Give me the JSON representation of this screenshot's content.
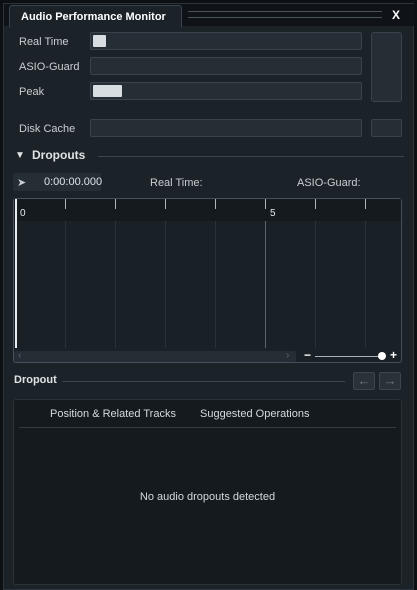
{
  "window": {
    "title": "Audio Performance Monitor",
    "close_label": "X"
  },
  "meters": {
    "real_time": {
      "label": "Real Time",
      "level": 0.05
    },
    "asio_guard": {
      "label": "ASIO-Guard",
      "level": 0.0
    },
    "peak": {
      "label": "Peak",
      "level": 0.11
    },
    "disk_cache": {
      "label": "Disk Cache",
      "level": 0.0
    }
  },
  "dropouts": {
    "title": "Dropouts",
    "time_value": "0:00:00.000",
    "real_time_label": "Real Time:",
    "asio_guard_label": "ASIO-Guard:",
    "ruler_labels": [
      "0",
      "5"
    ]
  },
  "dropout_list": {
    "title": "Dropout",
    "columns": [
      "Position & Related Tracks",
      "Suggested Operations"
    ],
    "empty_message": "No audio dropouts detected"
  },
  "icons": {
    "section_toggle": "triangle-down-icon",
    "time_icon": "pin-icon",
    "prev": "arrow-left-icon",
    "next": "arrow-right-icon",
    "zoom_out": "minus-icon",
    "zoom_in": "plus-icon"
  },
  "colors": {
    "background": "#1b2228",
    "meter_fill": "#d8dde2"
  }
}
